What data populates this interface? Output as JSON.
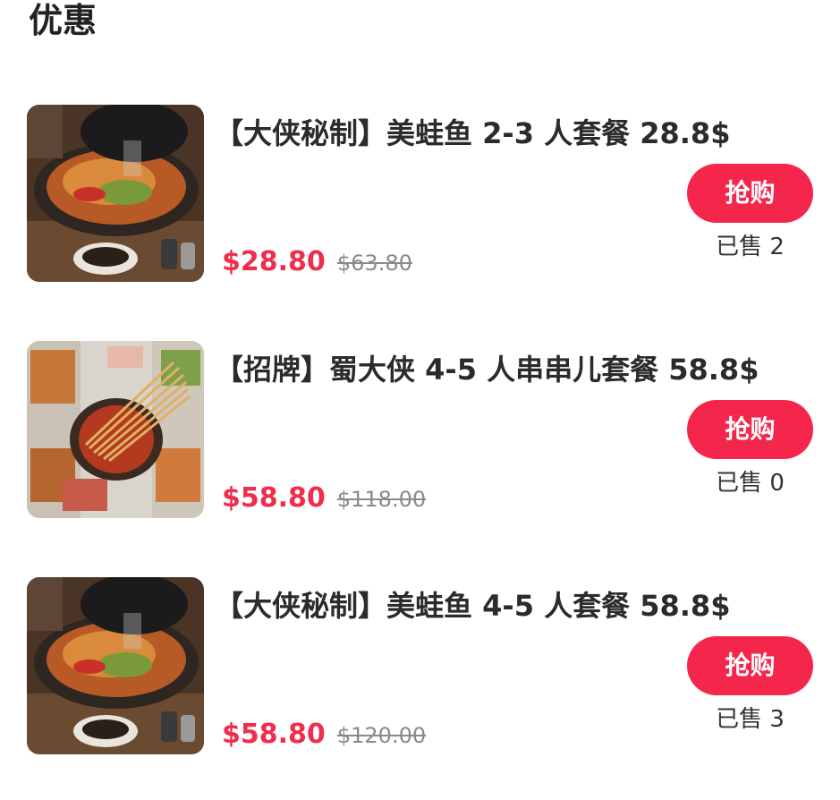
{
  "section_title": "优惠",
  "deals": [
    {
      "title": "【大侠秘制】美蛙鱼 2-3 人套餐 28.8$",
      "price": "$28.80",
      "original_price": "$63.80",
      "buy_label": "抢购",
      "sold": "已售 2",
      "image": "hotpot-fish-image"
    },
    {
      "title": "【招牌】蜀大侠 4-5 人串串儿套餐 58.8$",
      "price": "$58.80",
      "original_price": "$118.00",
      "buy_label": "抢购",
      "sold": "已售 0",
      "image": "skewer-hotpot-image"
    },
    {
      "title": "【大侠秘制】美蛙鱼 4-5 人套餐 58.8$",
      "price": "$58.80",
      "original_price": "$120.00",
      "buy_label": "抢购",
      "sold": "已售 3",
      "image": "hotpot-fish-image"
    }
  ],
  "colors": {
    "accent": "#f5264b",
    "price": "#ef2d4d",
    "text": "#222222",
    "muted": "#8a8a8a"
  }
}
